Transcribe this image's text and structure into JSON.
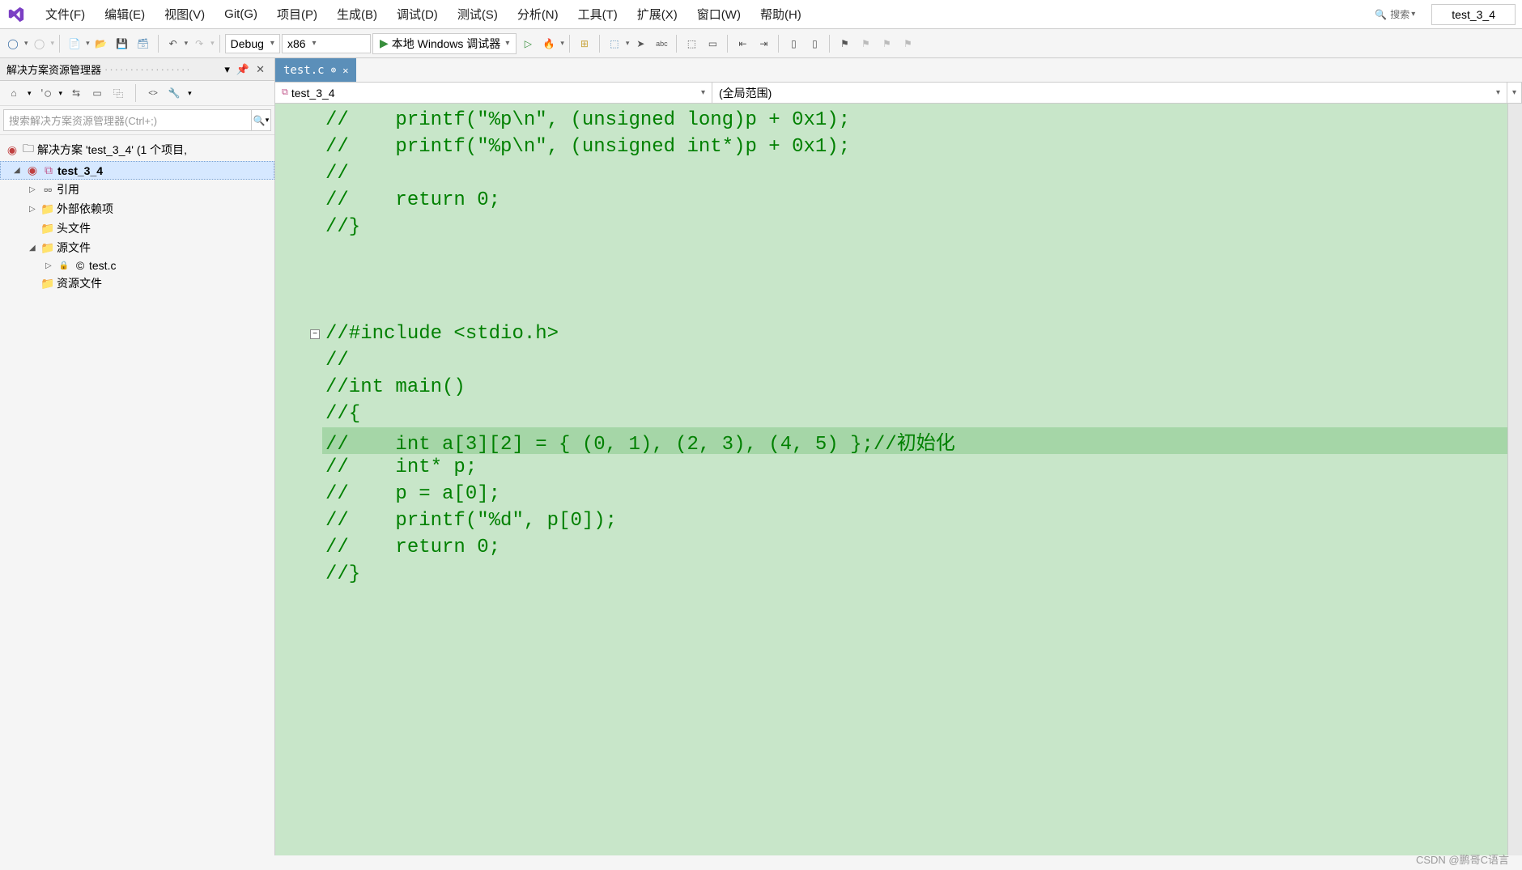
{
  "menubar": {
    "items": [
      {
        "label": "文件(F)"
      },
      {
        "label": "编辑(E)"
      },
      {
        "label": "视图(V)"
      },
      {
        "label": "Git(G)"
      },
      {
        "label": "项目(P)"
      },
      {
        "label": "生成(B)"
      },
      {
        "label": "调试(D)"
      },
      {
        "label": "测试(S)"
      },
      {
        "label": "分析(N)"
      },
      {
        "label": "工具(T)"
      },
      {
        "label": "扩展(X)"
      },
      {
        "label": "窗口(W)"
      },
      {
        "label": "帮助(H)"
      }
    ],
    "search_label": "搜索",
    "title": "test_3_4"
  },
  "toolbar": {
    "config": "Debug",
    "platform": "x86",
    "run_label": "本地 Windows 调试器"
  },
  "solution_explorer": {
    "title": "解决方案资源管理器",
    "search_placeholder": "搜索解决方案资源管理器(Ctrl+;)",
    "solution_label": "解决方案 'test_3_4' (1 个项目,",
    "project": "test_3_4",
    "nodes": {
      "references": "引用",
      "external_deps": "外部依赖项",
      "headers": "头文件",
      "sources": "源文件",
      "source_file": "test.c",
      "resources": "资源文件"
    }
  },
  "editor": {
    "tab_name": "test.c",
    "nav_left": "test_3_4",
    "nav_right": "(全局范围)",
    "code_lines": [
      "//    printf(\"%p\\n\", (unsigned long)p + 0x1);",
      "//    printf(\"%p\\n\", (unsigned int*)p + 0x1);",
      "//",
      "//    return 0;",
      "//}",
      "",
      "",
      "",
      "//#include <stdio.h>",
      "//",
      "//int main()",
      "//{",
      "//    int a[3][2] = { (0, 1), (2, 3), (4, 5) };//初始化",
      "//    int* p;",
      "//    p = a[0];",
      "//    printf(\"%d\", p[0]);",
      "//    return 0;",
      "//}"
    ],
    "highlighted_line": 12,
    "fold_line": 8
  },
  "watermark": "CSDN @鹏哥C语言"
}
